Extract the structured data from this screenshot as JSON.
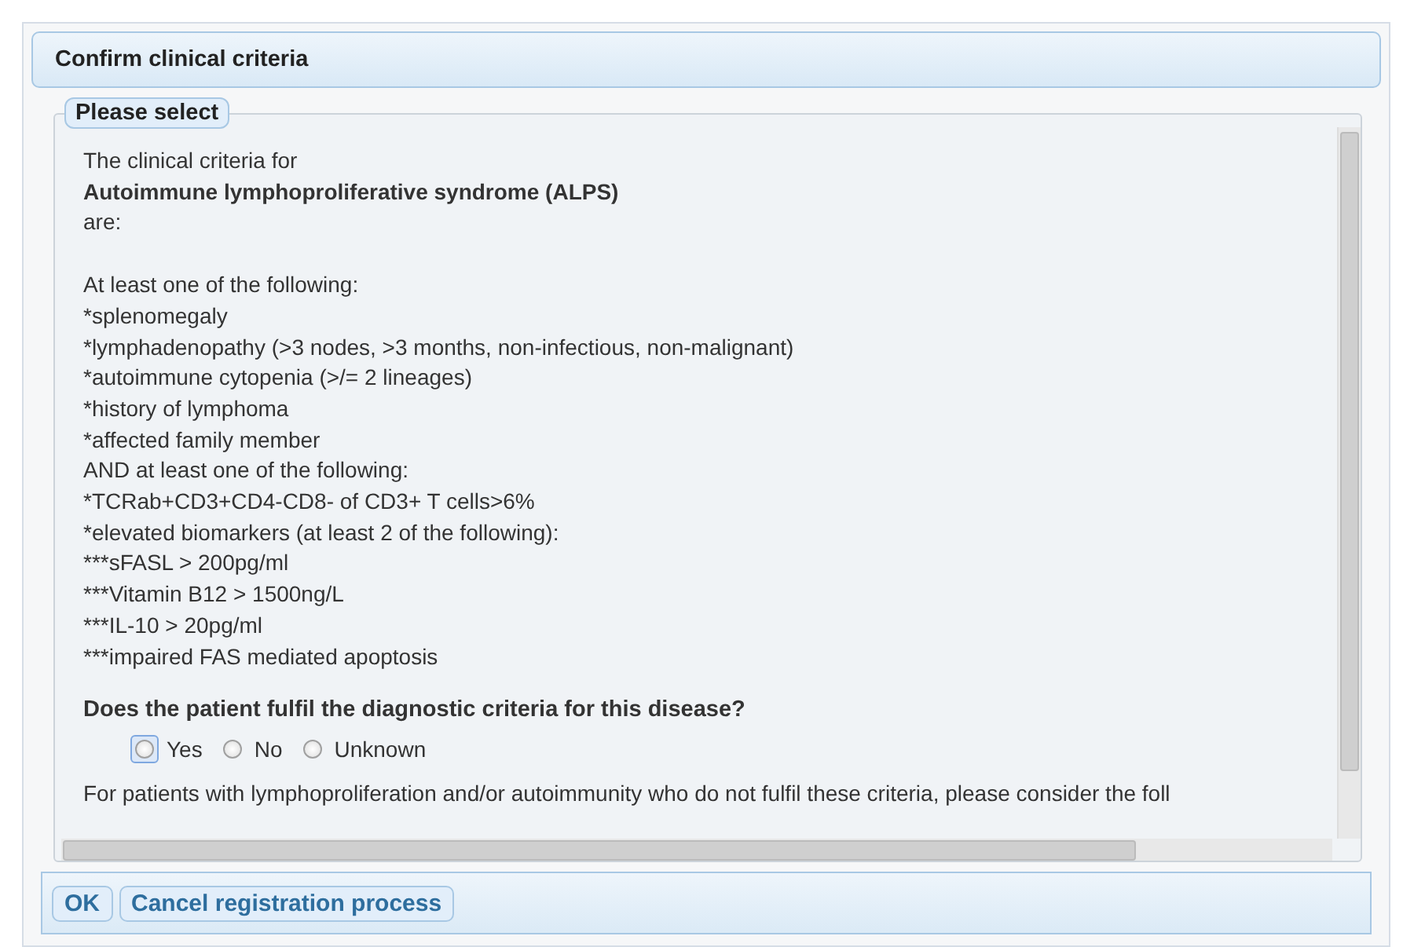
{
  "dialog": {
    "title": "Confirm clinical criteria"
  },
  "fieldset": {
    "legend": "Please select"
  },
  "intro": [
    "The clinical criteria for"
  ],
  "disease": "Autoimmune lymphoproliferative syndrome (ALPS)",
  "after": "are:",
  "criteria": [
    "At least one of the following:",
    "*splenomegaly",
    "*lymphadenopathy (>3 nodes, >3 months, non-infectious, non-malignant)",
    "*autoimmune cytopenia (>/= 2 lineages)",
    "*history of lymphoma",
    "*affected family member",
    "AND at least one of the following:",
    "*TCRab+CD3+CD4-CD8- of CD3+ T cells>6%",
    "*elevated biomarkers (at least 2 of the following):",
    "***sFASL > 200pg/ml",
    "***Vitamin B12 > 1500ng/L",
    "***IL-10 > 20pg/ml",
    "***impaired FAS mediated apoptosis"
  ],
  "question": "Does the patient fulfil the diagnostic criteria for this disease?",
  "options": [
    {
      "label": "Yes",
      "selected": false,
      "focused": true
    },
    {
      "label": "No",
      "selected": false,
      "focused": false
    },
    {
      "label": "Unknown",
      "selected": false,
      "focused": false
    }
  ],
  "note": "For patients with lymphoproliferation and/or autoimmunity who do not fulfil these criteria, please consider the foll",
  "buttons": [
    "OK",
    "Cancel registration process"
  ]
}
